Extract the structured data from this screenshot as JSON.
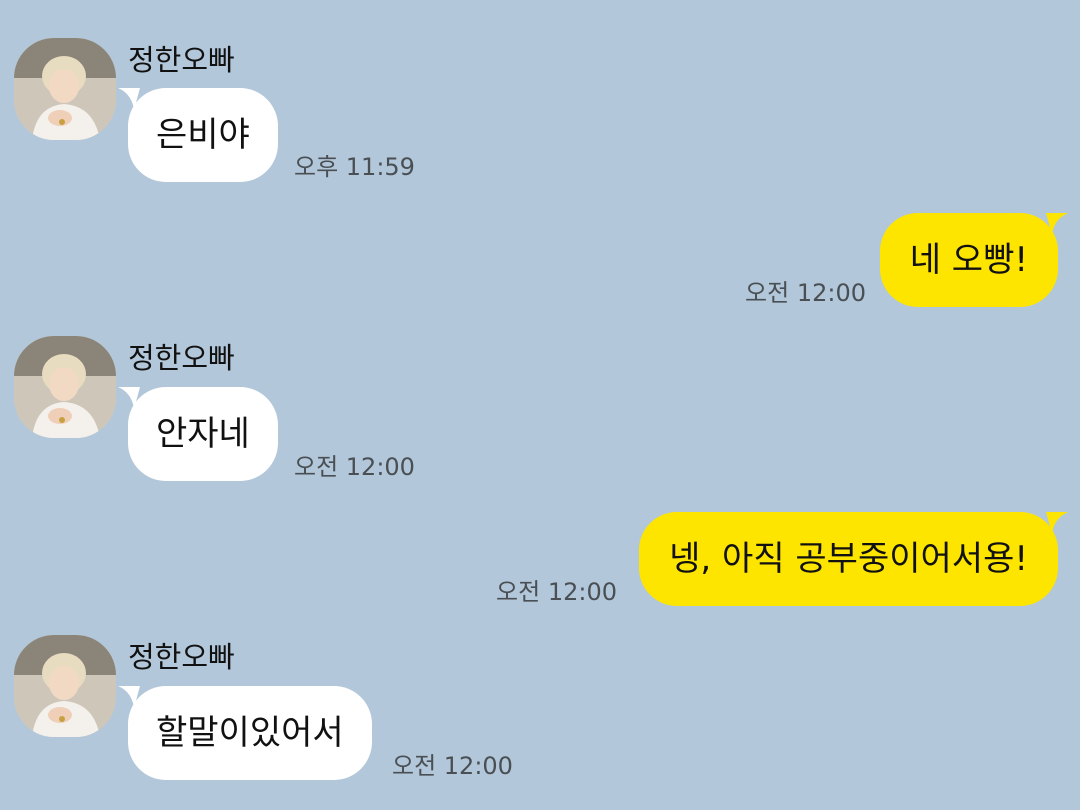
{
  "chat": {
    "messages": [
      {
        "type": "in",
        "sender": "정한오빠",
        "text": "은비야",
        "time": "오후 11:59"
      },
      {
        "type": "out",
        "text": "네 오빵!",
        "time": "오전 12:00"
      },
      {
        "type": "in",
        "sender": "정한오빠",
        "text": "안자네",
        "time": "오전 12:00"
      },
      {
        "type": "out",
        "text": "넹, 아직 공부중이어서용!",
        "time": "오전 12:00"
      },
      {
        "type": "in",
        "sender": "정한오빠",
        "text": "할말이있어서",
        "time": "오전 12:00"
      }
    ]
  },
  "colors": {
    "background": "#B2C7D9",
    "incoming_bubble": "#FFFFFF",
    "outgoing_bubble": "#FEE500"
  },
  "icons": {
    "avatar": "profile-photo-avatar"
  }
}
